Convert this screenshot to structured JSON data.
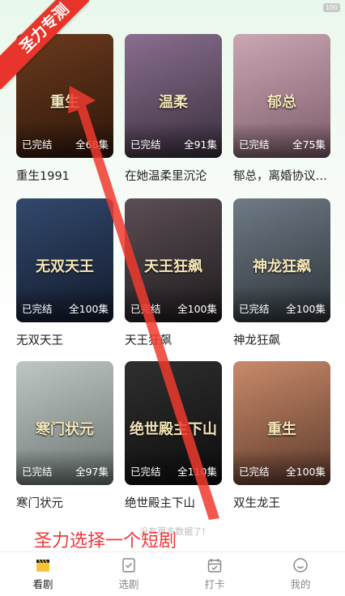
{
  "status_bar": {
    "badge": "100"
  },
  "dramas": [
    {
      "title": "重生1991",
      "status": "已完结",
      "episodes": "全68集",
      "art_text": "重生",
      "colors": [
        "#6b3b1e",
        "#2e160a"
      ]
    },
    {
      "title": "在她温柔里沉沦",
      "status": "已完结",
      "episodes": "全91集",
      "art_text": "温柔",
      "colors": [
        "#8a6f8f",
        "#3a2f3d"
      ]
    },
    {
      "title": "郁总，离婚协议请签收",
      "status": "已完结",
      "episodes": "全75集",
      "art_text": "郁总",
      "colors": [
        "#caa6b3",
        "#7d5c6b"
      ]
    },
    {
      "title": "无双天王",
      "status": "已完结",
      "episodes": "全100集",
      "art_text": "无双天王",
      "colors": [
        "#32496d",
        "#121a2b"
      ]
    },
    {
      "title": "天王狂飙",
      "status": "已完结",
      "episodes": "全100集",
      "art_text": "天王狂飙",
      "colors": [
        "#5b4f55",
        "#1e1a1d"
      ]
    },
    {
      "title": "神龙狂飙",
      "status": "已完结",
      "episodes": "全100集",
      "art_text": "神龙狂飙",
      "colors": [
        "#6f7b86",
        "#2c3238"
      ]
    },
    {
      "title": "寒门状元",
      "status": "已完结",
      "episodes": "全97集",
      "art_text": "寒门状元",
      "colors": [
        "#bfc7c4",
        "#6c7573"
      ]
    },
    {
      "title": "绝世殿主下山",
      "status": "已完结",
      "episodes": "全110集",
      "art_text": "绝世殿主下山",
      "colors": [
        "#2f2f2f",
        "#0d0d0d"
      ]
    },
    {
      "title": "双生龙王",
      "status": "已完结",
      "episodes": "全100集",
      "art_text": "重生",
      "colors": [
        "#c98a6a",
        "#5c3a2c"
      ]
    }
  ],
  "no_more_text": "没有更多数据了!",
  "tabs": [
    {
      "label": "看剧",
      "icon": "clapperboard-icon",
      "active": true
    },
    {
      "label": "选剧",
      "icon": "checklist-icon",
      "active": false
    },
    {
      "label": "打卡",
      "icon": "calendar-icon",
      "active": false
    },
    {
      "label": "我的",
      "icon": "smiley-icon",
      "active": false
    }
  ],
  "overlay": {
    "ribbon_text": "圣力专测",
    "annotation_text": "圣力选择一个短剧",
    "annotation_color": "#f0383b"
  },
  "colors": {
    "accent_active": "#f5c43a",
    "tab_inactive": "#888888"
  }
}
